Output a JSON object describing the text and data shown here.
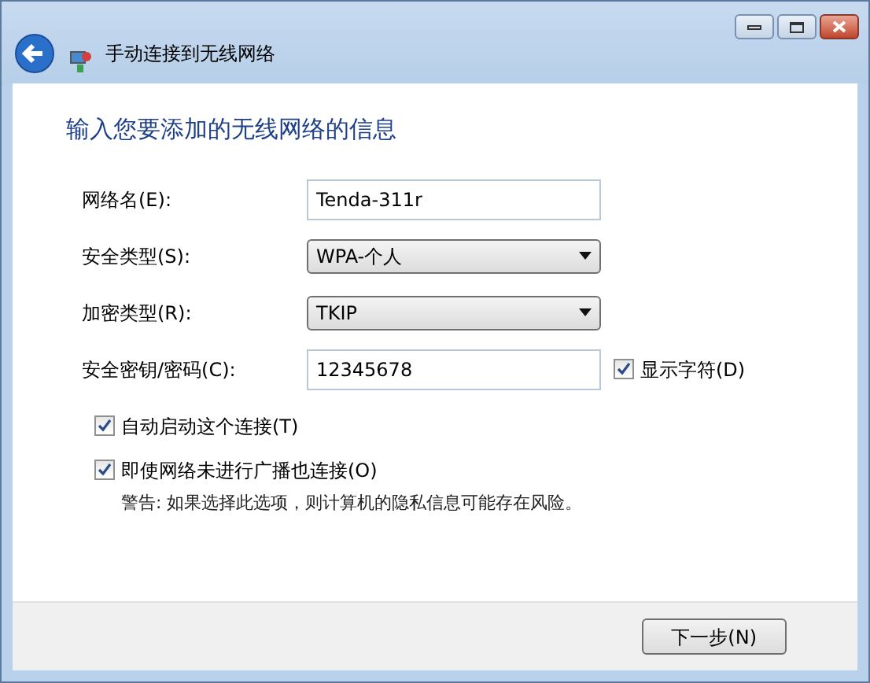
{
  "window": {
    "title": "手动连接到无线网络"
  },
  "heading": "输入您要添加的无线网络的信息",
  "fields": [
    {
      "kind": "text",
      "label": "网络名(E):",
      "value": "Tenda-311r"
    },
    {
      "kind": "select",
      "label": "安全类型(S):",
      "value": "WPA-个人"
    },
    {
      "kind": "select",
      "label": "加密类型(R):",
      "value": "TKIP"
    },
    {
      "kind": "text",
      "label": "安全密钥/密码(C):",
      "value": "12345678",
      "option": {
        "label": "显示字符(D)",
        "checked": true
      }
    }
  ],
  "options": [
    {
      "label": "自动启动这个连接(T)",
      "checked": true
    },
    {
      "label": "即使网络未进行广播也连接(O)",
      "checked": true,
      "note": "警告: 如果选择此选项，则计算机的隐私信息可能存在风险。"
    }
  ],
  "buttons": [
    {
      "label": "下一步(N)"
    }
  ]
}
